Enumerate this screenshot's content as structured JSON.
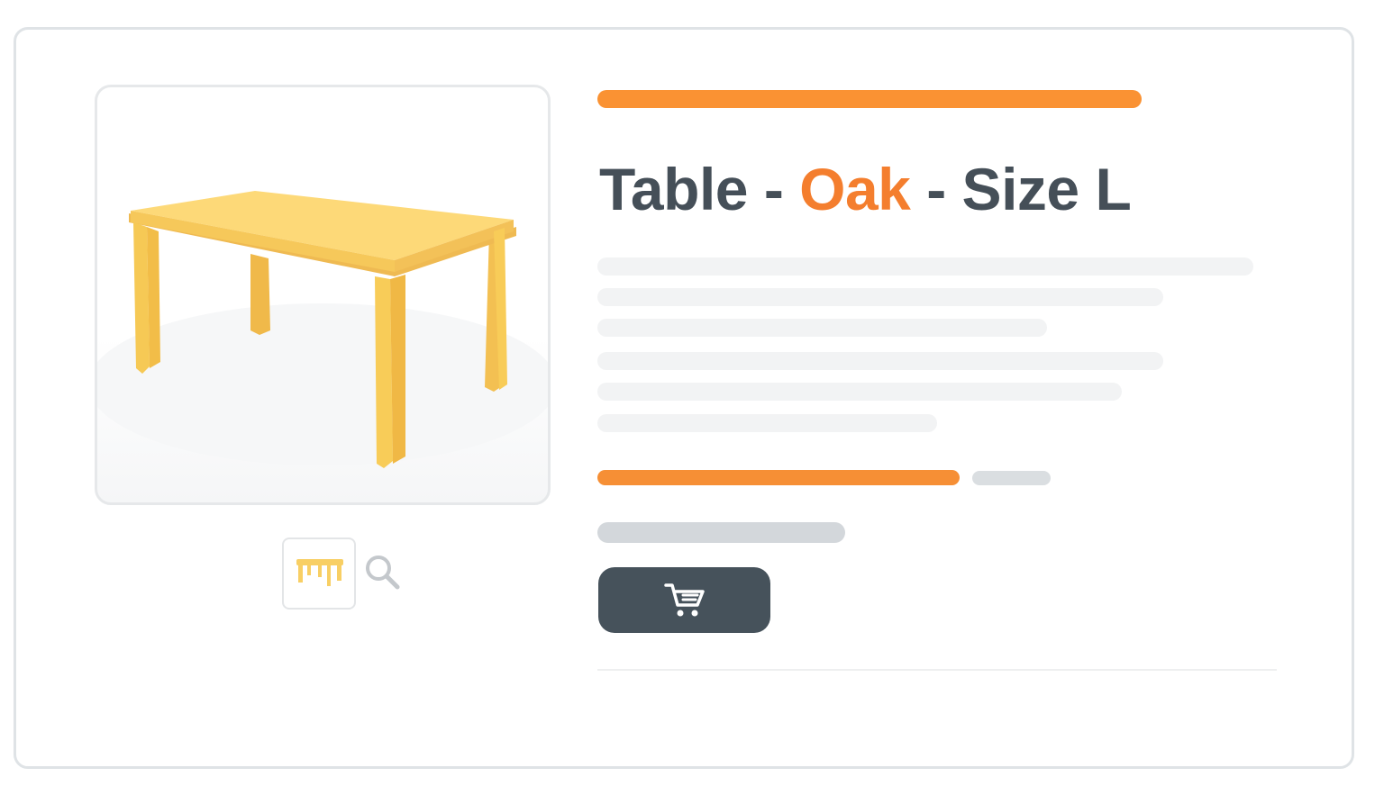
{
  "product": {
    "title_before": "Table - ",
    "title_accent": "Oak",
    "title_after": " - Size L",
    "image_icon": "table-image",
    "thumbnail_icon": "table-thumbnail-icon",
    "zoom_icon": "magnifier-icon"
  },
  "actions": {
    "add_to_cart_icon": "shopping-cart-icon"
  },
  "colors": {
    "accent": "#f47e2e",
    "bar_accent": "#fa9233",
    "title": "#454f58",
    "button": "#46525b",
    "table_wood": "#f8cc58"
  }
}
